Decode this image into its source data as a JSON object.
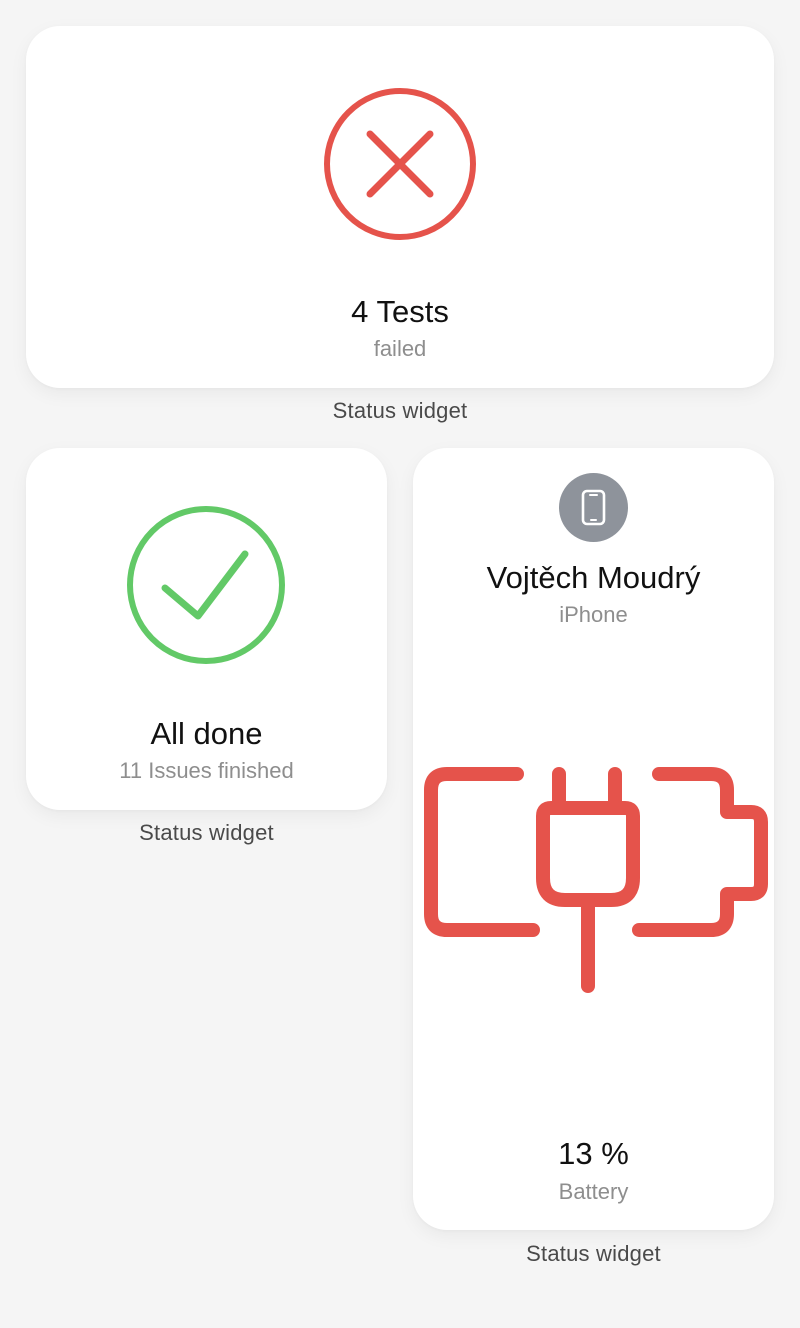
{
  "widgets": [
    {
      "title": "4 Tests",
      "subtitle": "failed",
      "caption": "Status widget",
      "icon": "x-circle-icon",
      "color": "#e5534b"
    },
    {
      "title": "All done",
      "subtitle": "11 Issues finished",
      "caption": "Status widget",
      "icon": "check-circle-icon",
      "color": "#62c967"
    },
    {
      "device_name": "Vojtěch Moudrý",
      "device_type": "iPhone",
      "device_icon": "smartphone-icon",
      "battery_icon": "battery-charging-plug-icon",
      "value": "13 %",
      "label": "Battery",
      "caption": "Status widget",
      "color": "#e5534b",
      "badge_color": "#8e939b"
    }
  ]
}
